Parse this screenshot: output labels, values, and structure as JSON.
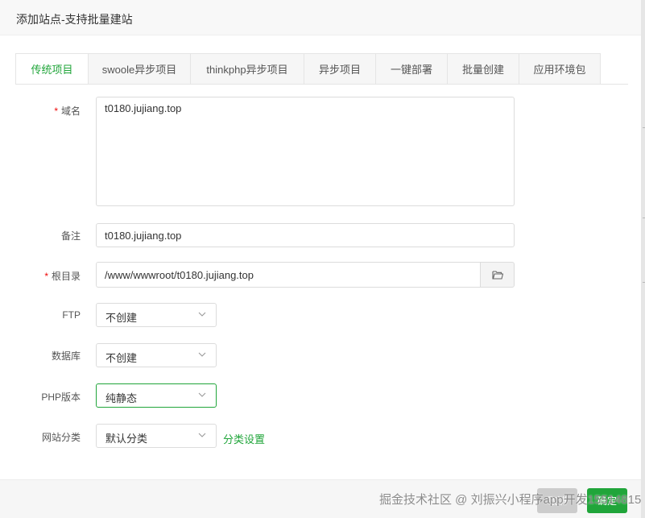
{
  "dialog": {
    "title": "添加站点-支持批量建站"
  },
  "tabs": [
    {
      "label": "传统项目",
      "active": true
    },
    {
      "label": "swoole异步项目",
      "active": false
    },
    {
      "label": "thinkphp异步项目",
      "active": false
    },
    {
      "label": "异步项目",
      "active": false
    },
    {
      "label": "一键部署",
      "active": false
    },
    {
      "label": "批量创建",
      "active": false
    },
    {
      "label": "应用环境包",
      "active": false
    }
  ],
  "form": {
    "domain": {
      "label": "域名",
      "required_mark": "*",
      "value": "t0180.jujiang.top"
    },
    "remark": {
      "label": "备注",
      "value": "t0180.jujiang.top"
    },
    "root": {
      "label": "根目录",
      "required_mark": "*",
      "value": "/www/wwwroot/t0180.jujiang.top",
      "button_icon": "folder-icon"
    },
    "ftp": {
      "label": "FTP",
      "value": "不创建"
    },
    "database": {
      "label": "数据库",
      "value": "不创建"
    },
    "php": {
      "label": "PHP版本",
      "value": "纯静态"
    },
    "category": {
      "label": "网站分类",
      "value": "默认分类",
      "link": "分类设置"
    }
  },
  "footer": {
    "cancel": "取消",
    "ok": "确定"
  },
  "watermark": "掘金技术社区 @ 刘振兴小程序app开发15514815",
  "colors": {
    "accent": "#20a53a",
    "required": "#ef0808",
    "cancel_bg": "#cccccc"
  }
}
